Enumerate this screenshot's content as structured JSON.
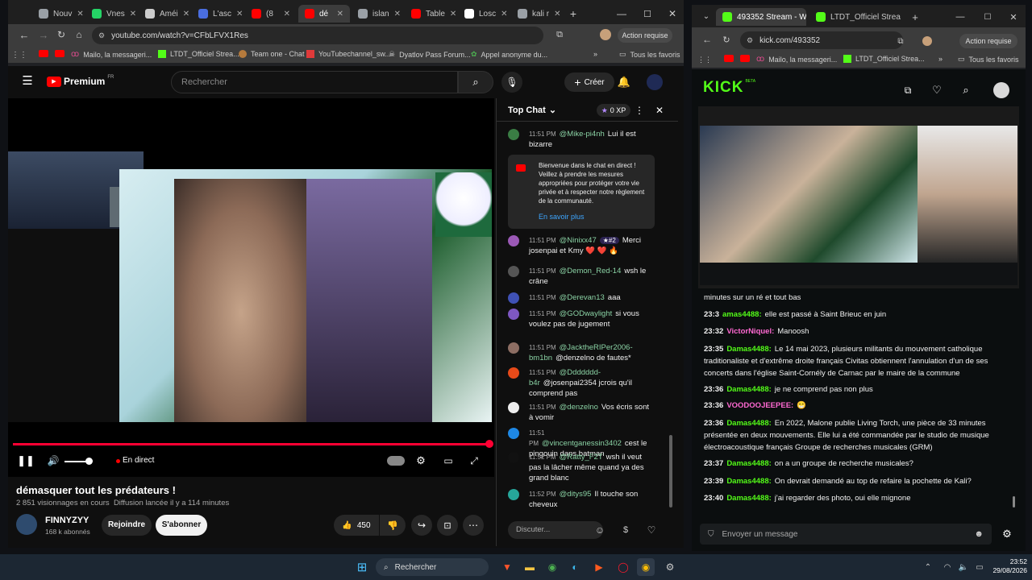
{
  "left_browser": {
    "tabs": [
      {
        "label": "Nouv",
        "color": "#9aa0a6"
      },
      {
        "label": "Vnes",
        "color": "#25d366"
      },
      {
        "label": "Améi",
        "color": "#cccccc"
      },
      {
        "label": "L'asc",
        "color": "#4a6ee0"
      },
      {
        "label": "(8",
        "color": "#ff0000"
      },
      {
        "label": "dé",
        "color": "#ff0000"
      },
      {
        "label": "islan",
        "color": "#9aa0a6"
      },
      {
        "label": "Table",
        "color": "#ff0000"
      },
      {
        "label": "Losc",
        "color": "#ffffff"
      },
      {
        "label": "kali r",
        "color": "#9aa0a6"
      }
    ],
    "url": "youtube.com/watch?v=CFbLFVX1Res",
    "action_label": "Action requise",
    "bookmarks": [
      "",
      "",
      "Mailo, la messageri...",
      "LTDT_Officiel Strea...",
      "Team one - Chat",
      "YouTubechannel_sw...",
      "Dyatlov Pass Forum...",
      "Appel anonyme du..."
    ],
    "all_bookmarks": "Tous les favoris"
  },
  "youtube": {
    "logo_text": "Premium",
    "logo_region": "FR",
    "search_placeholder": "Rechercher",
    "create_label": "Créer",
    "live_label": "En direct",
    "title": "démasquer tout les prédateurs !",
    "meta": "2 851 visionnages en cours  Diffusion lancée il y a 114 minutes",
    "channel_name": "FINNYZYY",
    "subscribers": "168 k abonnés",
    "join_label": "Rejoindre",
    "subscribe_label": "S'abonner",
    "like_count": "450",
    "progress": 1.0
  },
  "chat": {
    "header": "Top Chat",
    "xp": "0 XP",
    "welcome_text": "Bienvenue dans le chat en direct ! Veillez à prendre les mesures appropriées pour protéger votre vie privée et à respecter notre règlement de la communauté.",
    "learn_more": "En savoir plus",
    "input_placeholder": "Discuter...",
    "messages": [
      {
        "time": "11:51 PM",
        "user": "@Mike-pi4nh",
        "text": "Lui il est bizarre",
        "color": "#3a7d44"
      },
      {
        "time": "11:51 PM",
        "user": "@Ninixx47",
        "badge": "#2",
        "text": "Merci josenpai et Kmy ❤️ ❤️ 🔥",
        "color": "#9b59b6"
      },
      {
        "time": "11:51 PM",
        "user": "@Demon_Red-14",
        "text": "wsh le crâne",
        "color": "#555555"
      },
      {
        "time": "11:51 PM",
        "user": "@Derevan13",
        "text": "aaa",
        "color": "#3f51b5"
      },
      {
        "time": "11:51 PM",
        "user": "@GODwaylight",
        "text": "si vous voulez pas de jugement",
        "color": "#7e57c2"
      },
      {
        "time": "11:51 PM",
        "user": "@JackthеRIPer2006-bm1bn",
        "text": "@denzelno de fautes*",
        "color": "#8d6e63"
      },
      {
        "time": "11:51 PM",
        "user": "@Ddddddd-b4r",
        "text": "@josenpai2354 jcrois qu'il comprend pas",
        "color": "#e64a19"
      },
      {
        "time": "11:51 PM",
        "user": "@denzelno",
        "text": "Vos écris sont à vomir",
        "color": "#eeeeee"
      },
      {
        "time": "11:51 PM",
        "user": "@vincentganessin3402",
        "text": "cest le pingouin dans batman",
        "color": "#1e88e5"
      },
      {
        "time": "11:52 PM",
        "user": "@Ratty_F2T",
        "text": "wsh il veut pas la lâcher même quand ya des grand blanc",
        "color": "#111111"
      },
      {
        "time": "11:52 PM",
        "user": "@ditys95",
        "text": "Il touche son cheveux",
        "color": "#26a69a"
      }
    ]
  },
  "right_browser": {
    "tabs": [
      {
        "label": "493352 Stream - W",
        "color": "#53fc18"
      },
      {
        "label": "LTDT_Officiel Strea",
        "color": "#53fc18"
      }
    ],
    "url": "kick.com/493352",
    "action_label": "Action requise",
    "bookmarks": [
      "",
      "",
      "Mailo, la messageri...",
      "LTDT_Officiel Strea..."
    ],
    "all_bookmarks": "Tous les favoris"
  },
  "kick": {
    "logo": "KICK",
    "logo_badge": "BETA",
    "send_placeholder": "Envoyer un message",
    "messages": [
      {
        "time": "",
        "user": "",
        "text": "minutes sur un ré et tout bas"
      },
      {
        "time": "23:3",
        "user": "amas4488:",
        "text": "elle est passé à Saint Brieuc en juin"
      },
      {
        "time": "23:32",
        "user": "VictorNiquel:",
        "text": "Manoosh",
        "pink": true
      },
      {
        "time": "23:35",
        "user": "Damas4488:",
        "text": "Le 14 mai 2023, plusieurs militants du mouvement catholique traditionaliste et d'extrême droite français Civitas obtiennent l'annulation d'un de ses concerts dans l'église Saint-Cornély de Carnac par le maire de la commune"
      },
      {
        "time": "23:36",
        "user": "Damas4488:",
        "text": "je ne comprend pas non plus"
      },
      {
        "time": "23:36",
        "user": "VOODOOJEEPEE:",
        "text": "😁",
        "pink": true
      },
      {
        "time": "23:36",
        "user": "Damas4488:",
        "text": "En 2022, Malone publie Living Torch, une pièce de 33 minutes présentée en deux mouvements. Elle lui a été commandée par le studio de musique électroacoustique français Groupe de recherches musicales (GRM)"
      },
      {
        "time": "23:37",
        "user": "Damas4488:",
        "text": "on a un groupe de recherche musicales?"
      },
      {
        "time": "23:39",
        "user": "Damas4488:",
        "text": "On devrait demandé au top de refaire la pochette de Kali?"
      },
      {
        "time": "23:40",
        "user": "Damas4488:",
        "text": "j'ai regarder des photo, oui elle mignone"
      }
    ]
  },
  "taskbar": {
    "search_label": "Rechercher",
    "time": "23:52",
    "date": "29/08/2026"
  }
}
